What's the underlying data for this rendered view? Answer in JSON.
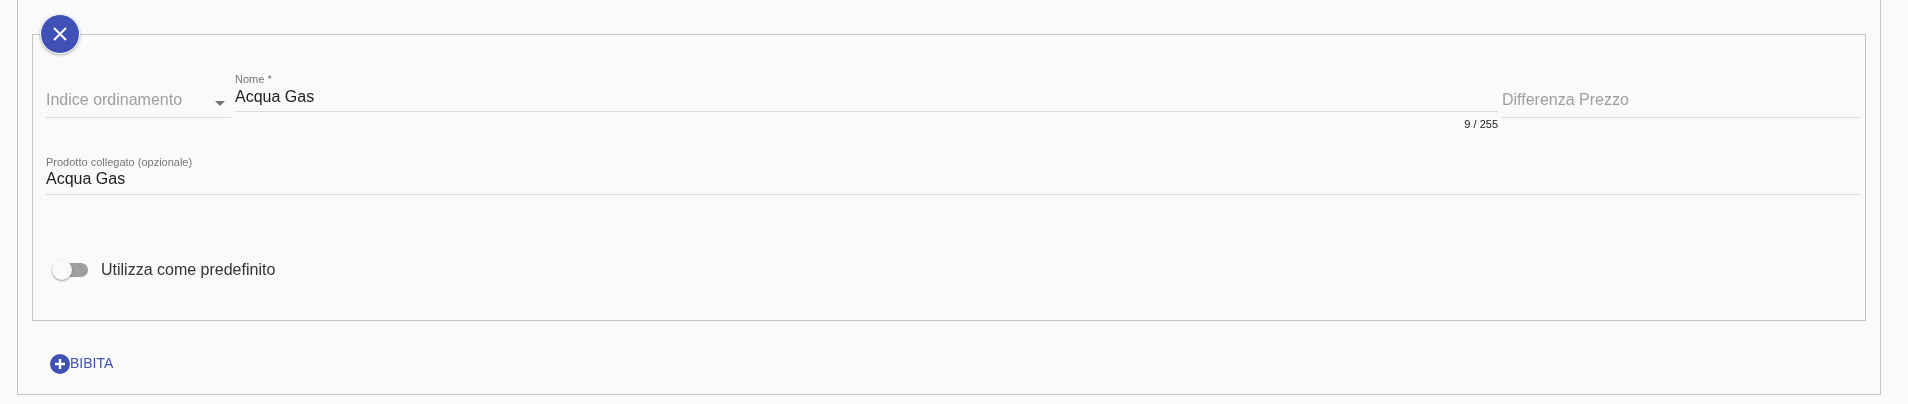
{
  "sort_select": {
    "placeholder": "Indice ordinamento"
  },
  "name_field": {
    "label": "Nome *",
    "value": "Acqua Gas",
    "counter": "9 / 255"
  },
  "price_field": {
    "placeholder": "Differenza Prezzo"
  },
  "linked_product": {
    "label": "Prodotto collegato (opzionale)",
    "value": "Acqua Gas"
  },
  "default_toggle": {
    "label": "Utilizza come predefinito",
    "on": false
  },
  "add_button": {
    "label": "BIBITA"
  }
}
